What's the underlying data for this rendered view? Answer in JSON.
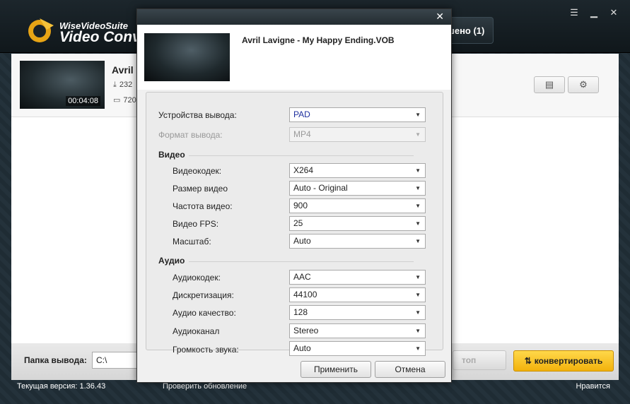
{
  "app": {
    "brand_small": "WiseVideoSuite",
    "brand_big": "Video Conve",
    "done_tab_label": "шено (1)",
    "window_controls": [
      "menu-icon",
      "minimize-icon",
      "close-icon"
    ]
  },
  "file_item": {
    "name": "Avril L",
    "duration": "00:04:08",
    "meta_size": "232",
    "meta_resolution": "720"
  },
  "bottom": {
    "output_label": "Папка вывода:",
    "output_path": "C:\\",
    "stop_label": "топ",
    "convert_label": "конвертировать"
  },
  "status": {
    "version": "Текущая версия: 1.36.43",
    "update_link": "Проверить обновление",
    "like_link": "Нравится"
  },
  "dialog": {
    "filename": "Avril Lavigne - My Happy Ending.VOB",
    "device_label": "Устройства вывода:",
    "device_value": "PAD",
    "format_label": "Формат вывода:",
    "format_value": "MP4",
    "video_section": "Видео",
    "video_rows": [
      {
        "label": "Видеокодек:",
        "value": "X264"
      },
      {
        "label": "Размер видео",
        "value": "Auto - Original"
      },
      {
        "label": "Частота видео:",
        "value": "900"
      },
      {
        "label": "Видео FPS:",
        "value": "25"
      },
      {
        "label": "Масштаб:",
        "value": "Auto"
      }
    ],
    "audio_section": "Аудио",
    "audio_rows": [
      {
        "label": "Аудиокодек:",
        "value": "AAC"
      },
      {
        "label": "Дискретизация:",
        "value": "44100"
      },
      {
        "label": "Аудио качество:",
        "value": "128"
      },
      {
        "label": "Аудиоканал",
        "value": "Stereo"
      },
      {
        "label": "Громкость звука:",
        "value": "Auto"
      }
    ],
    "apply_label": "Применить",
    "cancel_label": "Отмена"
  },
  "colors": {
    "accent": "#f2b20c",
    "device_value_color": "#1d2f9e"
  }
}
